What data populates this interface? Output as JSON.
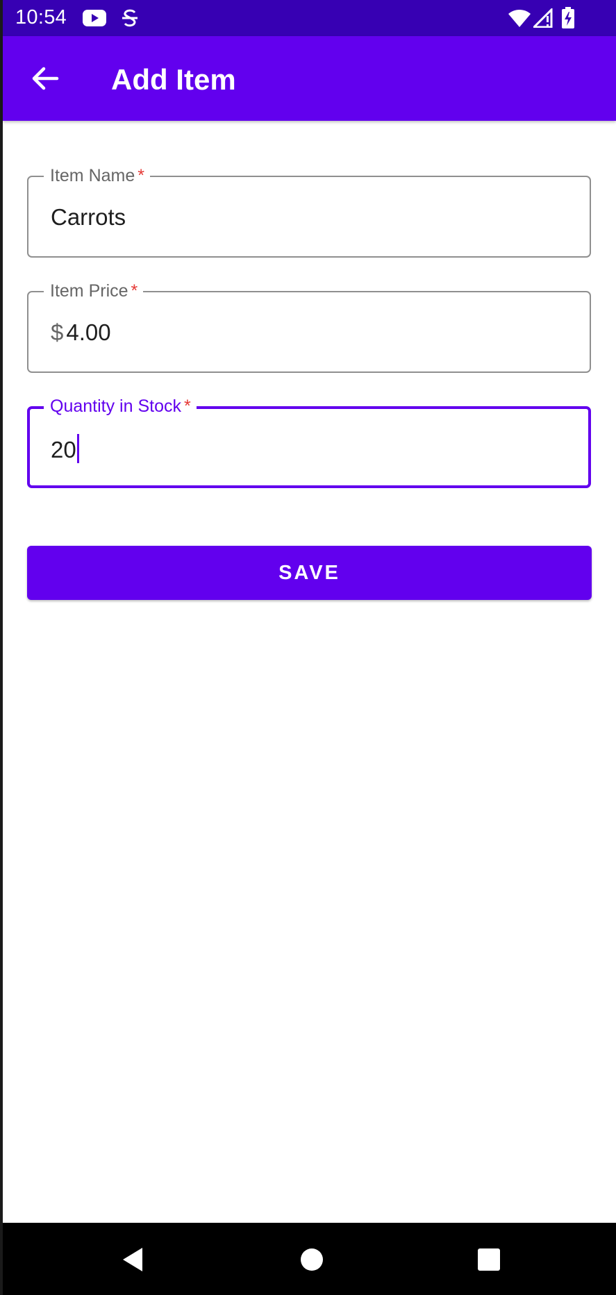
{
  "status_bar": {
    "time": "10:54",
    "icons": [
      "youtube-icon",
      "sync-icon",
      "wifi-icon",
      "signal-icon",
      "battery-icon"
    ]
  },
  "app_bar": {
    "title": "Add Item",
    "back_icon": "arrow-left-icon"
  },
  "form": {
    "item_name": {
      "label": "Item Name",
      "required_mark": "*",
      "value": "Carrots"
    },
    "item_price": {
      "label": "Item Price",
      "required_mark": "*",
      "prefix": "$",
      "value": "4.00"
    },
    "quantity": {
      "label": "Quantity in Stock",
      "required_mark": "*",
      "value": "20",
      "focused": true
    },
    "save_label": "SAVE"
  },
  "nav_bar": {
    "buttons": [
      "back-triangle-icon",
      "home-circle-icon",
      "recents-square-icon"
    ]
  },
  "colors": {
    "primary": "#6200ee",
    "primary_dark": "#3700b3",
    "error": "#e53935",
    "outline": "#8f8f8f"
  }
}
